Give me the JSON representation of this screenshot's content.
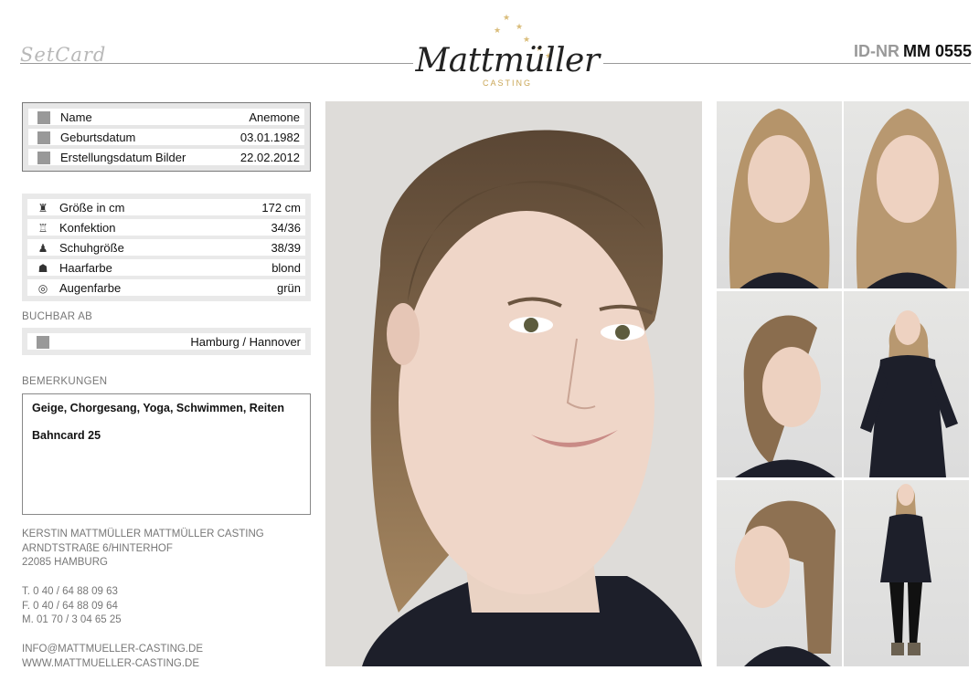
{
  "header": {
    "setcard_label": "SetCard",
    "logo_text": "Mattmüller",
    "logo_sub": "CASTING",
    "id_label": "ID-NR",
    "id_value": "MM 0555"
  },
  "basic_info": [
    {
      "label": "Name",
      "value": "Anemone"
    },
    {
      "label": "Geburtsdatum",
      "value": "03.01.1982"
    },
    {
      "label": "Erstellungsdatum Bilder",
      "value": "22.02.2012"
    }
  ],
  "measurements": [
    {
      "label": "Größe in cm",
      "value": "172 cm",
      "icon": "figure-icon"
    },
    {
      "label": "Konfektion",
      "value": "34/36",
      "icon": "clothing-icon"
    },
    {
      "label": "Schuhgröße",
      "value": "38/39",
      "icon": "shoe-icon"
    },
    {
      "label": "Haarfarbe",
      "value": "blond",
      "icon": "hair-icon"
    },
    {
      "label": "Augenfarbe",
      "value": "grün",
      "icon": "eye-icon"
    }
  ],
  "bookable": {
    "label": "BUCHBAR AB",
    "value": "Hamburg / Hannover"
  },
  "remarks": {
    "label": "BEMERKUNGEN",
    "lines": [
      "Geige, Chorgesang, Yoga, Schwimmen, Reiten",
      "Bahncard 25"
    ]
  },
  "contact": {
    "name": "KERSTIN MATTMÜLLER MATTMÜLLER CASTING",
    "street": "ARNDTSTRAßE 6/HINTERHOF",
    "city": "22085 HAMBURG",
    "phone": "T. 0 40 / 64 88 09 63",
    "fax": "F. 0 40 / 64 88 09 64",
    "mobile": "M. 01 70 / 3 04 65 25",
    "email": "INFO@MATTMUELLER-CASTING.DE",
    "web": "WWW.MATTMUELLER-CASTING.DE"
  },
  "colors": {
    "accent_gold": "#c9a656",
    "label_gray": "#777777",
    "panel_gray": "#e9e9e9"
  }
}
